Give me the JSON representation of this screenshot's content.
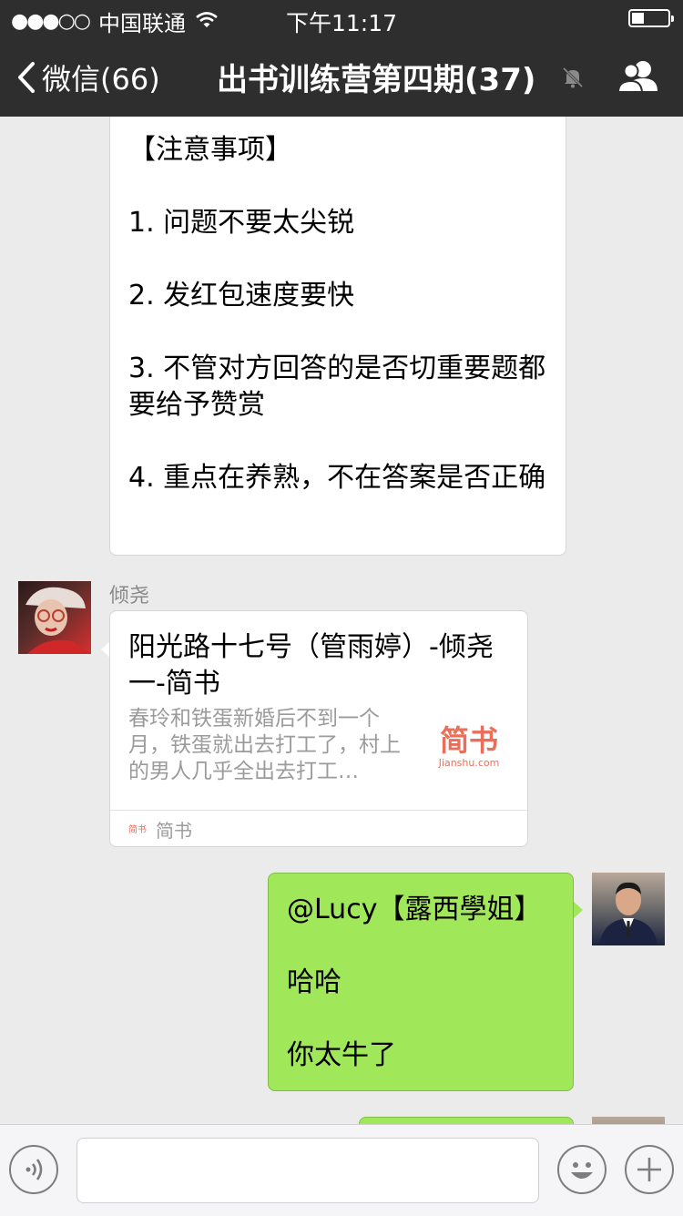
{
  "status_bar": {
    "signal_dots": "●●●○○",
    "carrier": "中国联通",
    "time": "下午11:17",
    "battery_level": 0.35
  },
  "nav": {
    "back_label": "微信(66)",
    "title": "出书训练营第四期(37)",
    "icons": [
      "chevron-left-icon",
      "mute-bell-icon",
      "group-members-icon"
    ]
  },
  "messages": {
    "notice": {
      "lines": [
        "【注意事项】",
        "1. 问题不要太尖锐",
        "2. 发红包速度要快",
        "3. 不管对方回答的是否切重要题都要给予赞赏",
        "4. 重点在养熟，不在答案是否正确"
      ]
    },
    "card": {
      "sender": "倾尧",
      "title": "阳光路十七号（管雨婷）-倾尧一-简书",
      "description": "春玲和铁蛋新婚后不到一个月，铁蛋就出去打工了，村上的男人几乎全出去打工…",
      "logo_main": "简书",
      "logo_sub": "Jianshu.com",
      "source_icon": "简书",
      "source": "简书"
    },
    "reply": {
      "lines": [
        "@Lucy【露西學姐】",
        "哈哈",
        "你太牛了"
      ]
    }
  },
  "input_bar": {
    "icons": [
      "voice-icon",
      "emoji-icon",
      "plus-icon"
    ],
    "text_value": ""
  },
  "colors": {
    "nav_bg": "#2e2e2e",
    "chat_bg": "#ebebeb",
    "green_bubble": "#a0e75a",
    "jianshu_red": "#ea6f5a"
  }
}
